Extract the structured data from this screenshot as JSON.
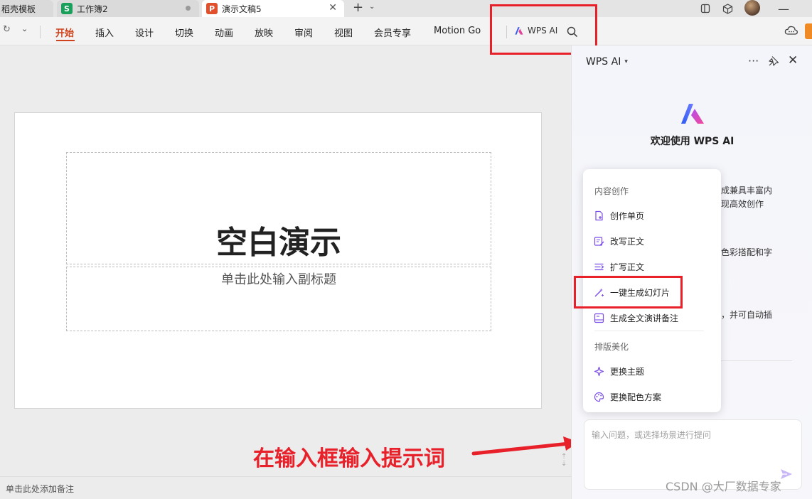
{
  "tabs": [
    {
      "label": "稻壳模板"
    },
    {
      "label": "工作簿2",
      "icon_letter": "S"
    },
    {
      "label": "演示文稿5",
      "icon_letter": "P"
    }
  ],
  "ribbon": {
    "menu": [
      "开始",
      "插入",
      "设计",
      "切换",
      "动画",
      "放映",
      "审阅",
      "视图",
      "会员专享",
      "Motion Go"
    ],
    "active": "开始",
    "wps_ai_label": "WPS AI"
  },
  "slide": {
    "title": "空白演示",
    "subtitle": "单击此处输入副标题"
  },
  "notes": {
    "placeholder": "单击此处添加备注"
  },
  "annotation": "在输入框输入提示词",
  "ai_panel": {
    "header": "WPS AI",
    "welcome": "欢迎使用 WPS AI",
    "bg_fragments": [
      "成兼具丰富内",
      "现高效创作",
      "色彩搭配和字",
      "，并可自动插"
    ],
    "input_placeholder": "输入问题，或选择场景进行提问"
  },
  "dropdown": {
    "section1": "内容创作",
    "items1": [
      "创作单页",
      "改写正文",
      "扩写正文",
      "一键生成幻灯片",
      "生成全文演讲备注"
    ],
    "section2": "排版美化",
    "items2": [
      "更换主题",
      "更换配色方案"
    ]
  },
  "watermark": "CSDN @大厂数据专家",
  "colors": {
    "accent": "#d0421b",
    "highlight": "#e8202a",
    "ai_purple": "#8a5cf5"
  }
}
